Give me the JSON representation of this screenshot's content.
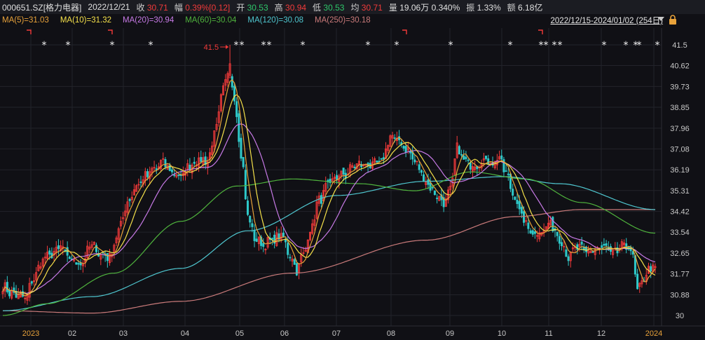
{
  "header": {
    "symbol": "000651.SZ[格力电器]",
    "date": "2022/12/21",
    "close_label": "收",
    "close": "30.71",
    "change_label": "幅",
    "change": "0.39%[0.12]",
    "open_label": "开",
    "open": "30.53",
    "high_label": "高",
    "high": "30.94",
    "low_label": "低",
    "low": "30.53",
    "avg_label": "均",
    "avg": "30.71",
    "volume_label": "量",
    "volume": "19.06万",
    "turnover_rate": "0.340%",
    "amplitude_label": "振",
    "amplitude": "1.33%",
    "amount_label": "额",
    "amount": "6.18亿",
    "date_range": "2022/12/15-2024/01/02 (254日)"
  },
  "moving_averages": [
    {
      "label": "MA(5)=31.03",
      "color": "#e8a23a"
    },
    {
      "label": "MA(10)=31.32",
      "color": "#f5e14a"
    },
    {
      "label": "MA(20)=30.94",
      "color": "#c77ae6"
    },
    {
      "label": "MA(60)=30.04",
      "color": "#4fb33d"
    },
    {
      "label": "MA(120)=30.08",
      "color": "#4fc6cf"
    },
    {
      "label": "MA(250)=30.18",
      "color": "#c97a7a"
    }
  ],
  "icons": {
    "dropdown": "chevron-down-icon",
    "lock": "lock-icon"
  },
  "colors": {
    "up": "#f23a3a",
    "down": "#2ec9c9",
    "background": "#101015",
    "accent_year": "#e8a23a"
  },
  "chart_data": {
    "type": "candlestick",
    "y_ticks": [
      "41.5",
      "40.62",
      "39.73",
      "38.85",
      "37.96",
      "37.08",
      "36.19",
      "35.31",
      "34.42",
      "33.54",
      "32.65",
      "31.77",
      "30.88",
      "30"
    ],
    "ylim": [
      30,
      41.5
    ],
    "x_ticks": [
      {
        "label": "2023",
        "year": true
      },
      {
        "label": "02"
      },
      {
        "label": "03"
      },
      {
        "label": "04"
      },
      {
        "label": "05"
      },
      {
        "label": "06"
      },
      {
        "label": "07"
      },
      {
        "label": "08"
      },
      {
        "label": "09"
      },
      {
        "label": "10"
      },
      {
        "label": "11"
      },
      {
        "label": "12"
      },
      {
        "label": "2024",
        "year": true
      }
    ],
    "max_annotation": "41.5",
    "close_anchors": [
      [
        0,
        31.2
      ],
      [
        5,
        30.9
      ],
      [
        10,
        30.75
      ],
      [
        14,
        31.6
      ],
      [
        18,
        32.4
      ],
      [
        22,
        32.6
      ],
      [
        26,
        32.9
      ],
      [
        30,
        32.4
      ],
      [
        35,
        32.2
      ],
      [
        40,
        33.0
      ],
      [
        44,
        32.6
      ],
      [
        48,
        32.5
      ],
      [
        52,
        33.6
      ],
      [
        56,
        34.8
      ],
      [
        60,
        35.5
      ],
      [
        64,
        35.9
      ],
      [
        68,
        36.2
      ],
      [
        72,
        36.5
      ],
      [
        76,
        36.1
      ],
      [
        80,
        35.9
      ],
      [
        84,
        36.4
      ],
      [
        88,
        36.6
      ],
      [
        92,
        36.6
      ],
      [
        96,
        38.0
      ],
      [
        99,
        39.7
      ],
      [
        102,
        40.5
      ],
      [
        104,
        39.2
      ],
      [
        107,
        36.8
      ],
      [
        110,
        34.3
      ],
      [
        113,
        33.3
      ],
      [
        117,
        33.0
      ],
      [
        121,
        33.2
      ],
      [
        125,
        33.4
      ],
      [
        129,
        32.6
      ],
      [
        132,
        31.95
      ],
      [
        135,
        32.6
      ],
      [
        138,
        33.6
      ],
      [
        142,
        34.9
      ],
      [
        146,
        35.5
      ],
      [
        150,
        35.9
      ],
      [
        154,
        36.0
      ],
      [
        158,
        36.4
      ],
      [
        162,
        36.4
      ],
      [
        166,
        36.4
      ],
      [
        170,
        36.5
      ],
      [
        174,
        37.6
      ],
      [
        178,
        37.4
      ],
      [
        182,
        37.0
      ],
      [
        186,
        36.4
      ],
      [
        190,
        35.7
      ],
      [
        194,
        35.2
      ],
      [
        198,
        34.8
      ],
      [
        201,
        35.3
      ],
      [
        204,
        37.1
      ],
      [
        208,
        36.5
      ],
      [
        212,
        36.4
      ],
      [
        216,
        36.6
      ],
      [
        220,
        36.5
      ],
      [
        223,
        36.7
      ],
      [
        226,
        36.0
      ],
      [
        230,
        35.0
      ],
      [
        234,
        34.0
      ],
      [
        238,
        33.5
      ],
      [
        242,
        33.6
      ],
      [
        246,
        33.9
      ],
      [
        250,
        33.3
      ],
      [
        254,
        32.5
      ],
      [
        258,
        32.9
      ],
      [
        262,
        32.7
      ],
      [
        266,
        32.8
      ],
      [
        270,
        32.9
      ],
      [
        274,
        32.6
      ],
      [
        278,
        32.9
      ],
      [
        281,
        32.95
      ],
      [
        283,
        32.5
      ],
      [
        285,
        31.0
      ],
      [
        288,
        31.6
      ],
      [
        291,
        32.1
      ],
      [
        293,
        31.9
      ]
    ],
    "ma120_anchors": [
      [
        0,
        30.2
      ],
      [
        40,
        30.8
      ],
      [
        80,
        32.0
      ],
      [
        110,
        33.6
      ],
      [
        150,
        35.1
      ],
      [
        190,
        35.7
      ],
      [
        225,
        35.9
      ],
      [
        250,
        35.6
      ],
      [
        293,
        34.5
      ]
    ],
    "ma250_anchors": [
      [
        0,
        30.2
      ],
      [
        40,
        30.1
      ],
      [
        80,
        30.6
      ],
      [
        130,
        31.8
      ],
      [
        190,
        33.2
      ],
      [
        230,
        34.2
      ],
      [
        260,
        34.5
      ],
      [
        293,
        34.5
      ]
    ],
    "ma60_anchors": [
      [
        0,
        30.0
      ],
      [
        20,
        30.5
      ],
      [
        50,
        31.8
      ],
      [
        80,
        34.0
      ],
      [
        105,
        35.5
      ],
      [
        130,
        35.8
      ],
      [
        160,
        35.6
      ],
      [
        185,
        35.3
      ],
      [
        210,
        36.1
      ],
      [
        235,
        35.8
      ],
      [
        260,
        34.8
      ],
      [
        293,
        33.5
      ]
    ],
    "star_x": [
      63,
      97,
      160,
      215,
      337,
      345,
      376,
      384,
      432,
      525,
      566,
      643,
      728,
      772,
      779,
      791,
      799,
      862,
      893,
      907,
      912,
      938
    ],
    "flag_x": [
      42,
      158,
      578,
      772
    ]
  }
}
